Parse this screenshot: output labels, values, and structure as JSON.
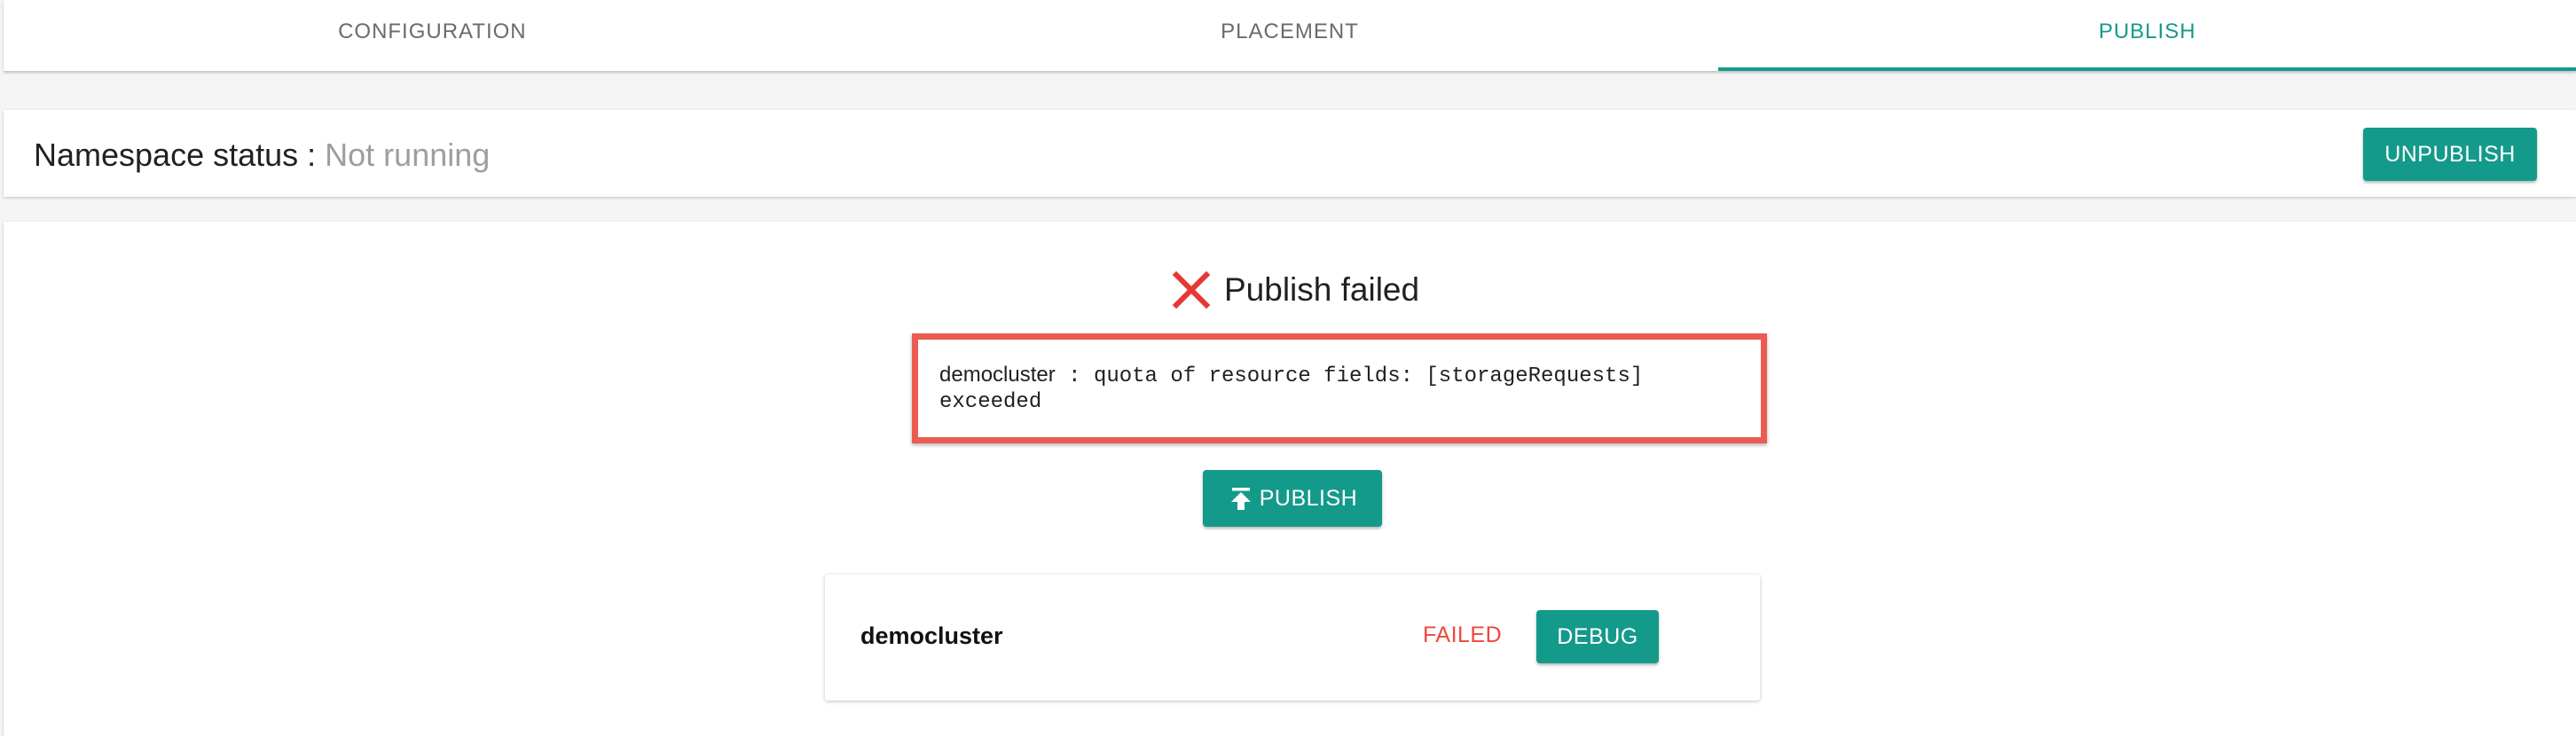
{
  "tabs": [
    {
      "label": "CONFIGURATION",
      "active": false
    },
    {
      "label": "PLACEMENT",
      "active": false
    },
    {
      "label": "PUBLISH",
      "active": true
    }
  ],
  "status": {
    "label": "Namespace status : ",
    "value": "Not running",
    "unpublish_label": "UNPUBLISH"
  },
  "result": {
    "icon": "x-icon",
    "title": "Publish failed",
    "error_cluster": "democluster",
    "error_message": " : quota of resource fields: [storageRequests] exceeded",
    "publish_label": "PUBLISH",
    "publish_icon": "upload-icon"
  },
  "cluster": {
    "name": "democluster",
    "state": "FAILED",
    "debug_label": "DEBUG"
  },
  "colors": {
    "accent": "#149a8b",
    "error": "#f0463c",
    "highlight_border": "#ec5b52"
  }
}
